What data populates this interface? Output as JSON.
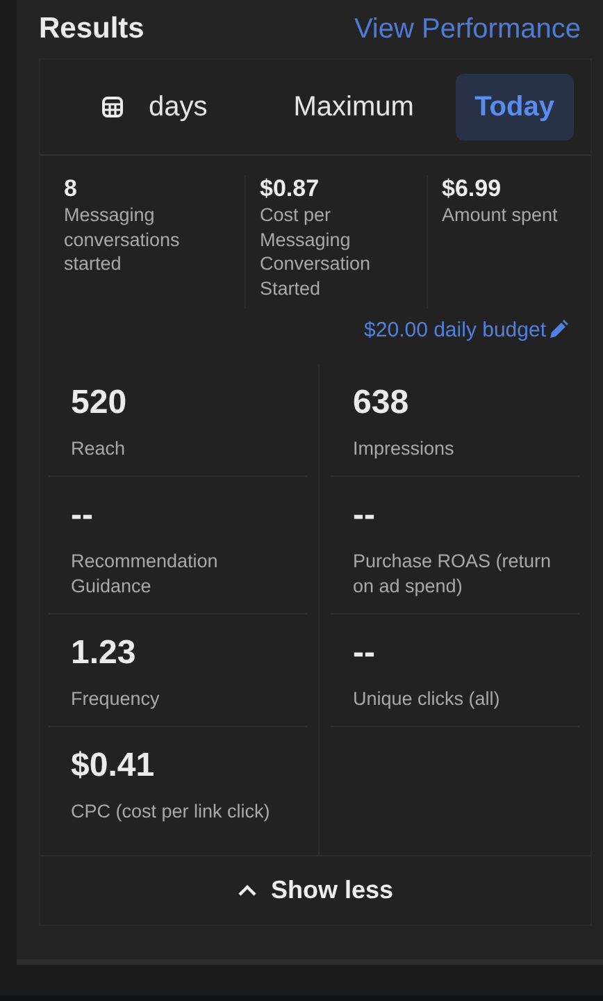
{
  "header": {
    "title": "Results",
    "link": "View Performance"
  },
  "tabs": [
    {
      "label": "days",
      "selected": false,
      "icon": true
    },
    {
      "label": "Maximum",
      "selected": false,
      "icon": false
    },
    {
      "label": "Today",
      "selected": true,
      "icon": false
    }
  ],
  "summary": [
    {
      "value": "8",
      "label": "Messaging conversations started"
    },
    {
      "value": "$0.87",
      "label": "Cost per Messaging Conversation Started"
    },
    {
      "value": "$6.99",
      "label": "Amount spent"
    }
  ],
  "budget": "$20.00 daily budget",
  "metrics": [
    [
      {
        "value": "520",
        "label": "Reach"
      },
      {
        "value": "--",
        "label": "Recommendation Guidance"
      },
      {
        "value": "1.23",
        "label": "Frequency"
      },
      {
        "value": "$0.41",
        "label": "CPC (cost per link click)"
      }
    ],
    [
      {
        "value": "638",
        "label": "Impressions"
      },
      {
        "value": "--",
        "label": "Purchase ROAS (return on ad spend)"
      },
      {
        "value": "--",
        "label": "Unique clicks (all)"
      }
    ]
  ],
  "toggle": "Show less"
}
